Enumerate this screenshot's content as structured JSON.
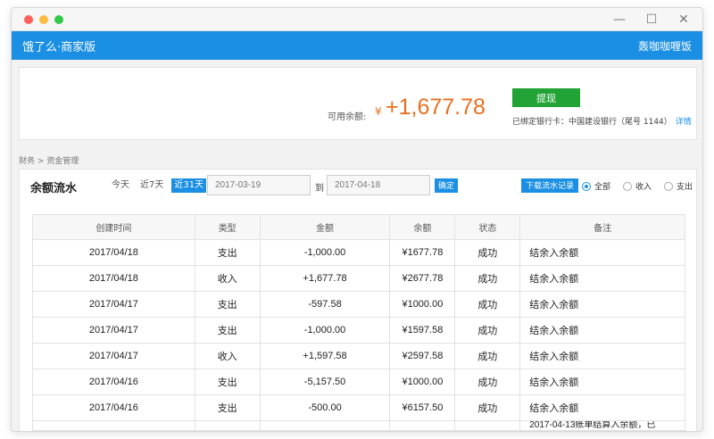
{
  "window": {
    "traffic_colors": [
      "#fc605c",
      "#fdbc40",
      "#34c84a"
    ],
    "controls": [
      "—",
      "☐",
      "✕"
    ]
  },
  "appbar": {
    "title": "饿了么·商家版",
    "shop_name": "轰咖咖喱饭",
    "color": "#1a8fe3"
  },
  "balance": {
    "label": "可用余额:",
    "currency": "¥",
    "amount": "+1,677.78",
    "withdraw_label": "提现",
    "bank_info": "已绑定银行卡：中国建设银行（尾号 1144）",
    "details_link": "详情"
  },
  "breadcrumb": "财务 > 资金管理",
  "ledger": {
    "title": "余额流水",
    "ranges": [
      {
        "label": "今天",
        "active": false
      },
      {
        "label": "近7天",
        "active": false
      },
      {
        "label": "近31天",
        "active": true
      }
    ],
    "date_from": "2017-03-19",
    "to_label": "到",
    "date_to": "2017-04-18",
    "confirm_label": "确定",
    "download_label": "下载流水记录",
    "filters": [
      {
        "label": "全部",
        "selected": true
      },
      {
        "label": "收入",
        "selected": false
      },
      {
        "label": "支出",
        "selected": false
      }
    ],
    "columns": [
      "创建时间",
      "类型",
      "金额",
      "余额",
      "状态",
      "备注"
    ],
    "rows": [
      [
        "2017/04/18",
        "支出",
        "-1,000.00",
        "¥1677.78",
        "成功",
        "结余入余额"
      ],
      [
        "2017/04/18",
        "收入",
        "+1,677.78",
        "¥2677.78",
        "成功",
        "结余入余额"
      ],
      [
        "2017/04/17",
        "支出",
        "-597.58",
        "¥1000.00",
        "成功",
        "结余入余额"
      ],
      [
        "2017/04/17",
        "支出",
        "-1,000.00",
        "¥1597.58",
        "成功",
        "结余入余额"
      ],
      [
        "2017/04/17",
        "收入",
        "+1,597.58",
        "¥2597.58",
        "成功",
        "结余入余额"
      ],
      [
        "2017/04/16",
        "支出",
        "-5,157.50",
        "¥1000.00",
        "成功",
        "结余入余额"
      ],
      [
        "2017/04/16",
        "支出",
        "-500.00",
        "¥6157.50",
        "成功",
        "结余入余额"
      ]
    ],
    "partial_row_note": "2017-04-13账单结算入余额，已"
  }
}
